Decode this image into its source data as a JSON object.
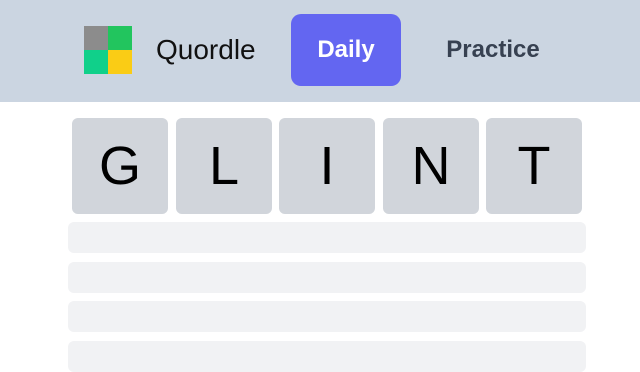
{
  "header": {
    "app_title": "Quordle",
    "tabs": [
      {
        "label": "Daily",
        "active": true
      },
      {
        "label": "Practice",
        "active": false
      }
    ],
    "logo_colors": [
      "#8c8c8c",
      "#22c55e",
      "#10d08a",
      "#facc15"
    ]
  },
  "board": {
    "guess_letters": [
      "G",
      "L",
      "I",
      "N",
      "T"
    ],
    "empty_rows": 4
  },
  "colors": {
    "header_bg": "#cbd5e1",
    "active_tab": "#6366f1",
    "tile_bg": "#d1d5db",
    "empty_row_bg": "#f1f2f4"
  }
}
